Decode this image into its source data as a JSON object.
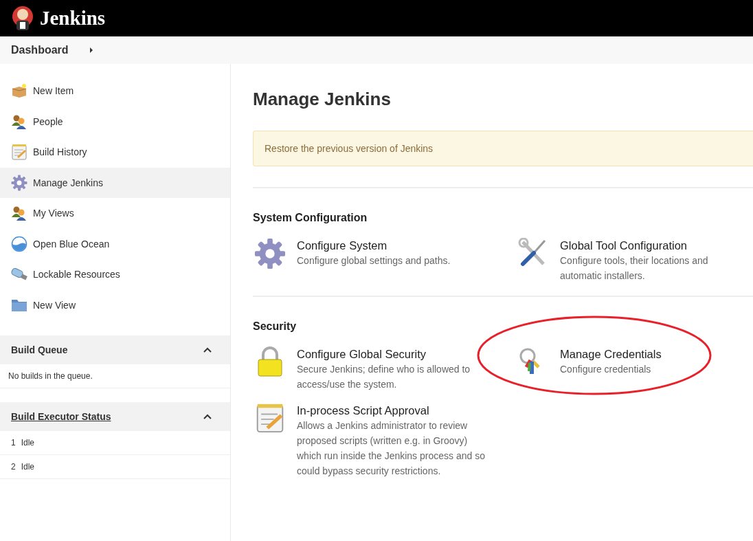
{
  "header": {
    "title": "Jenkins"
  },
  "breadcrumb": {
    "label": "Dashboard"
  },
  "sidebar": {
    "items": [
      {
        "label": "New Item",
        "selected": false
      },
      {
        "label": "People",
        "selected": false
      },
      {
        "label": "Build History",
        "selected": false
      },
      {
        "label": "Manage Jenkins",
        "selected": true
      },
      {
        "label": "My Views",
        "selected": false
      },
      {
        "label": "Open Blue Ocean",
        "selected": false
      },
      {
        "label": "Lockable Resources",
        "selected": false
      },
      {
        "label": "New View",
        "selected": false
      }
    ]
  },
  "build_queue": {
    "title": "Build Queue",
    "expanded": true,
    "message": "No builds in the queue."
  },
  "executor_status": {
    "title": "Build Executor Status",
    "expanded": true,
    "rows": [
      {
        "number": "1",
        "status": "Idle"
      },
      {
        "number": "2",
        "status": "Idle"
      }
    ]
  },
  "main": {
    "title": "Manage Jenkins",
    "notice": "Restore the previous version of Jenkins",
    "sections": [
      {
        "title": "System Configuration",
        "items": [
          {
            "title": "Configure System",
            "description": "Configure global settings and paths.",
            "highlighted": false
          },
          {
            "title": "Global Tool Configuration",
            "description": "Configure tools, their locations and automatic installers.",
            "highlighted": false
          }
        ]
      },
      {
        "title": "Security",
        "items": [
          {
            "title": "Configure Global Security",
            "description": "Secure Jenkins; define who is allowed to access/use the system.",
            "highlighted": false
          },
          {
            "title": "Manage Credentials",
            "description": "Configure credentials",
            "highlighted": true
          },
          {
            "title": "In-process Script Approval",
            "description": "Allows a Jenkins administrator to review proposed scripts (written e.g. in Groovy) which run inside the Jenkins process and so could bypass security restrictions.",
            "highlighted": false
          }
        ]
      }
    ]
  }
}
